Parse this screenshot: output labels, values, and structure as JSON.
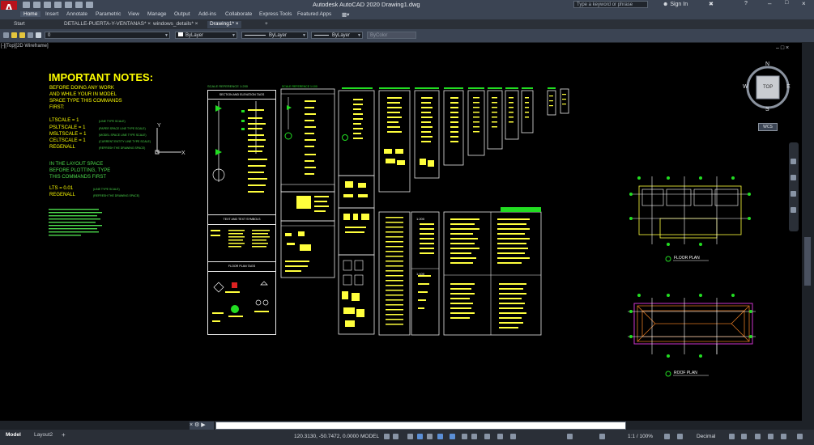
{
  "app": {
    "title": "Autodesk AutoCAD 2020   Drawing1.dwg",
    "logo_letter": "A",
    "search_placeholder": "Type a keyword or phrase",
    "sign_in": "Sign In"
  },
  "ribbon_tabs": [
    "Home",
    "Insert",
    "Annotate",
    "Parametric",
    "View",
    "Manage",
    "Output",
    "Add-ins",
    "Collaborate",
    "Express Tools",
    "Featured Apps"
  ],
  "doc_tabs": [
    "Start",
    "DETALLE-PUERTA-Y-VENTANAS*",
    "windows_details*",
    "Drawing1*"
  ],
  "properties_bar": {
    "layer_value": "0",
    "color": "ByLayer",
    "linetype": "ByLayer",
    "lineweight": "ByLayer",
    "plotstyle": "ByColor"
  },
  "notes": {
    "title": "IMPORTANT NOTES:",
    "intro": [
      "BEFORE DOING ANY WORK",
      "AND WHILE YOUR IN MODEL",
      "SPACE TYPE THIS COMMANDS",
      "FIRST:"
    ],
    "commands": [
      {
        "cmd": "LTSCALE = 1",
        "desc": "(LINE TYPE SCALE)"
      },
      {
        "cmd": "PSLTSCALE = 1",
        "desc": "(PAPER SPACE LINE TYPE SCALE)"
      },
      {
        "cmd": "MSLTSCALE = 1",
        "desc": "(MODEL SPACE LINE TYPE SCALE)"
      },
      {
        "cmd": "CELTSCALE = 1",
        "desc": "(CURRENT ENTITY LINE TYPE SCALE)"
      },
      {
        "cmd": "REGENALL",
        "desc": "(REFRESH THE DRAWING SPACE)"
      }
    ],
    "layout_intro": [
      "IN THE LAYOUT SPACE",
      "BEFORE PLOTTING, TYPE",
      "THIS COMMANDS FIRST"
    ],
    "layout_commands": [
      {
        "cmd": "LTS = 0.01",
        "desc": "(LINE TYPE SCALE)"
      },
      {
        "cmd": "REGENALL",
        "desc": "(REFRESH THE DRAWING SPACE)"
      }
    ]
  },
  "sheets": {
    "scale_reference": "SCALE REFERENCE 1:200",
    "section_elevation": "SECTION AND ELEVATION TAGS",
    "text_symbols": "TEXT AND TEXT SYMBOLS",
    "floor_plan_tags": "FLOOR PLAN TAGS"
  },
  "plans": {
    "floor_plan": "FLOOR PLAN",
    "roof_plan": "ROOF PLAN"
  },
  "viewcube": {
    "top": "TOP",
    "n": "N",
    "s": "S",
    "e": "E",
    "w": "W",
    "wcs": "WCS"
  },
  "status": {
    "model_tab": "Model",
    "layout_tab": "Layout2",
    "coords": "120.3130, -50.7472, 0.0000",
    "space": "MODEL",
    "scale": "1:1 / 100%",
    "units": "Decimal"
  },
  "colors": {
    "titlebar": "#3b4453",
    "canvas": "#000000",
    "yellow": "#ffff00",
    "green": "#4cd94c",
    "magenta": "#cc33cc"
  }
}
